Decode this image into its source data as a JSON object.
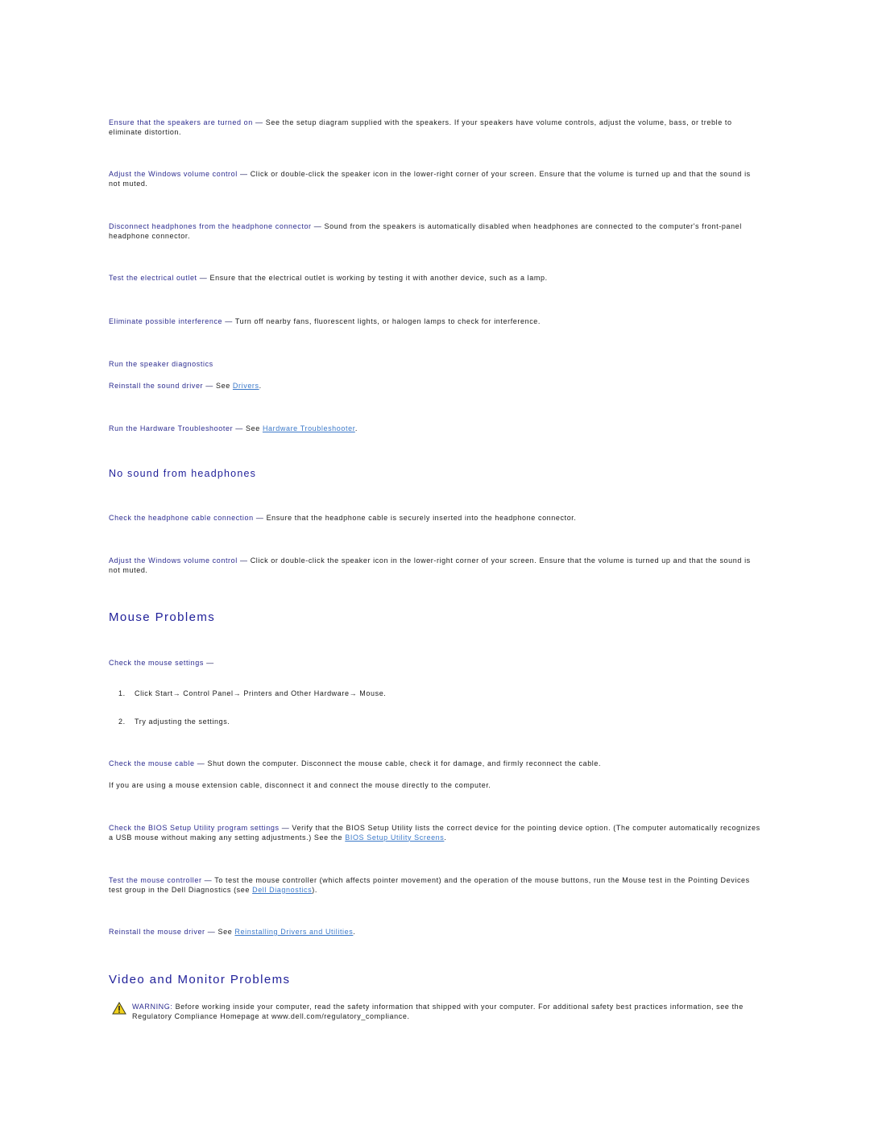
{
  "speaker_section": {
    "items": [
      {
        "term": "Ensure that the speakers are turned on",
        "text": "See the setup diagram supplied with the speakers. If your speakers have volume controls, adjust the volume, bass, or treble to eliminate distortion."
      },
      {
        "term": "Adjust the Windows volume control",
        "text": "Click or double-click the speaker icon in the lower-right corner of your screen. Ensure that the volume is turned up and that the sound is not muted."
      },
      {
        "term": "Disconnect headphones from the headphone connector",
        "text": "Sound from the speakers is automatically disabled when headphones are connected to the computer's front-panel headphone connector."
      },
      {
        "term": "Test the electrical outlet",
        "text": "Ensure that the electrical outlet is working by testing it with another device, such as a lamp."
      },
      {
        "term": "Eliminate possible interference",
        "text": "Turn off nearby fans, fluorescent lights, or halogen lamps to check for interference."
      }
    ],
    "run_diagnostics": "Run the speaker diagnostics",
    "reinstall_driver": {
      "term": "Reinstall the sound driver",
      "prefix": "See",
      "link": "Drivers",
      "suffix": "."
    },
    "hardware_troubleshooter": {
      "term": "Run the Hardware Troubleshooter",
      "prefix": "See",
      "link": "Hardware Troubleshooter",
      "suffix": "."
    }
  },
  "headphones_section": {
    "title": "No sound from headphones",
    "items": [
      {
        "term": "Check the headphone cable connection",
        "text": "Ensure that the headphone cable is securely inserted into the headphone connector."
      },
      {
        "term": "Adjust the Windows volume control",
        "text": "Click or double-click the speaker icon in the lower-right corner of your screen. Ensure that the volume is turned up and that the sound is not muted."
      }
    ]
  },
  "mouse_section": {
    "title": "Mouse Problems",
    "settings_term": "Check the mouse settings",
    "steps": [
      {
        "num": "1.",
        "text": "Click Start→ Control Panel→ Printers and Other Hardware→ Mouse."
      },
      {
        "num": "2.",
        "text": "Try adjusting the settings."
      }
    ],
    "cable": {
      "term": "Check the mouse cable",
      "text": "Shut down the computer. Disconnect the mouse cable, check it for damage, and firmly reconnect the cable."
    },
    "extension_note": "If you are using a mouse extension cable, disconnect it and connect the mouse directly to the computer.",
    "bios": {
      "term": "Check the BIOS Setup Utility program settings",
      "text": "Verify that the BIOS Setup Utility lists the correct device for the pointing device option. (The computer automatically recognizes a USB mouse without making any setting adjustments.) See the",
      "link": "BIOS Setup Utility Screens",
      "suffix": "."
    },
    "controller": {
      "term": "Test the mouse controller",
      "text": "To test the mouse controller (which affects pointer movement) and the operation of the mouse buttons, run the Mouse test in the Pointing Devices test group in the Dell Diagnostics (see",
      "link": "Dell Diagnostics",
      "suffix": ")."
    },
    "driver": {
      "term": "Reinstall the mouse driver",
      "prefix": "See",
      "link": "Reinstalling Drivers and Utilities",
      "suffix": "."
    }
  },
  "video_section": {
    "title": "Video and Monitor Problems",
    "warning_label": "WARNING:",
    "warning_text": "Before working inside your computer, read the safety information that shipped with your computer. For additional safety best practices information, see the Regulatory Compliance Homepage at www.dell.com/regulatory_compliance."
  },
  "dash": "—",
  "colors": {
    "term": "#2b2b8f",
    "heading": "#1f1f99",
    "link": "#3a78c9",
    "warning_icon": "#f2d21b"
  }
}
